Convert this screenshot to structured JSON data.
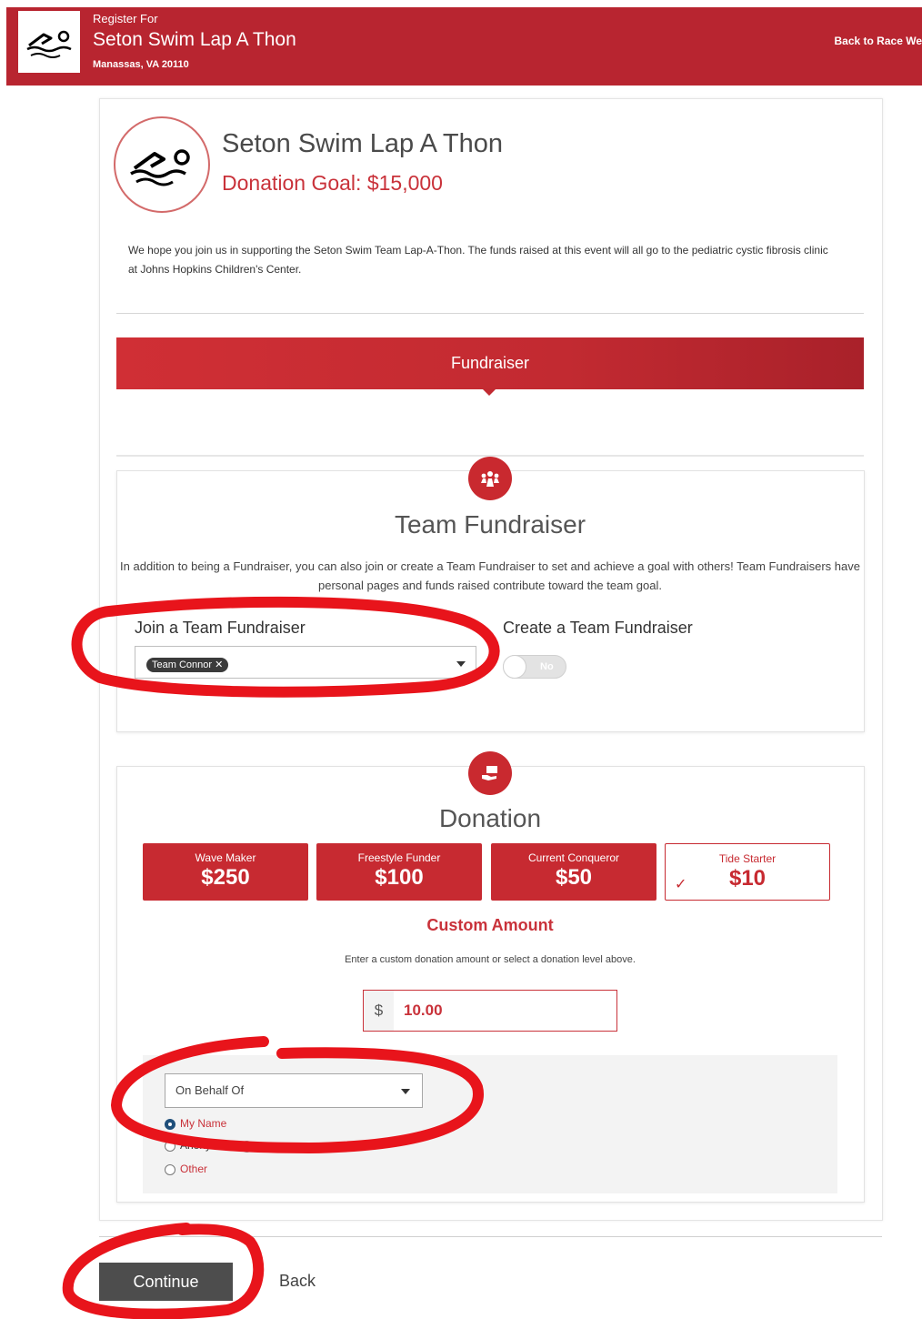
{
  "header": {
    "register_for": "Register For",
    "event_name": "Seton Swim Lap A Thon",
    "location": "Manassas, VA 20110",
    "back_link": "Back to Race We"
  },
  "event": {
    "title": "Seton Swim Lap A Thon",
    "goal": "Donation Goal: $15,000",
    "description": "We hope you join us in supporting the Seton Swim Team Lap-A-Thon. The funds raised at this event will all go to the pediatric cystic fibrosis clinic at Johns Hopkins Children's Center."
  },
  "fundraiser_tab": "Fundraiser",
  "team": {
    "title": "Team Fundraiser",
    "description": "In addition to being a Fundraiser, you can also join or create a Team Fundraiser to set and achieve a goal with others! Team Fundraisers have personal pages and funds raised contribute toward the team goal.",
    "join_label": "Join a Team Fundraiser",
    "selected_team": "Team Connor",
    "create_label": "Create a Team Fundraiser",
    "create_toggle": "No"
  },
  "donation": {
    "title": "Donation",
    "levels": [
      {
        "name": "Wave Maker",
        "amount": "$250"
      },
      {
        "name": "Freestyle Funder",
        "amount": "$100"
      },
      {
        "name": "Current Conqueror",
        "amount": "$50"
      },
      {
        "name": "Tide Starter",
        "amount": "$10",
        "selected": true
      }
    ],
    "custom_title": "Custom Amount",
    "custom_hint": "Enter a custom donation amount or select a donation level above.",
    "currency": "$",
    "amount": "10.00",
    "on_behalf_placeholder": "On Behalf Of",
    "options": [
      "My Name",
      "Anonymous",
      "Other"
    ]
  },
  "actions": {
    "continue": "Continue",
    "back": "Back"
  },
  "colors": {
    "brand_red": "#b82530",
    "accent_red": "#c9323a",
    "button_dark": "#4d4d4d"
  }
}
